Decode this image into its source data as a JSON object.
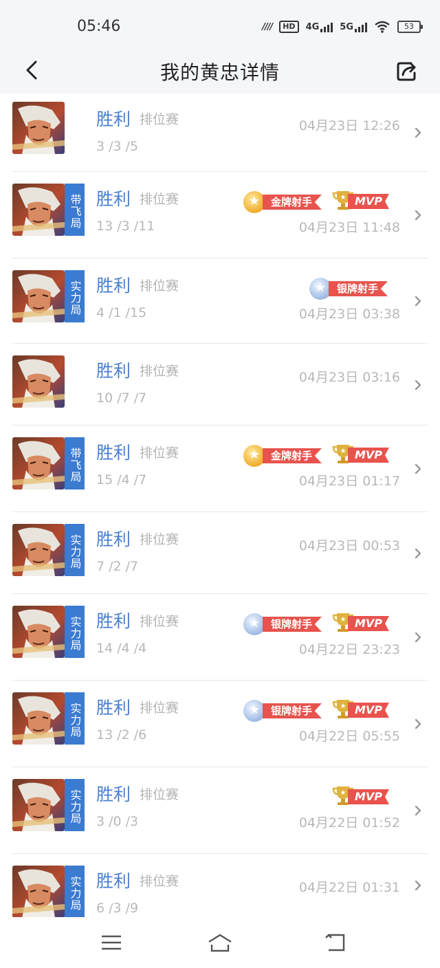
{
  "status": {
    "time": "05:46",
    "hd": "HD",
    "sig4g": "4G",
    "sig5g": "5G",
    "battery": "53"
  },
  "nav": {
    "title": "我的黄忠详情"
  },
  "matches": [
    {
      "result": "胜利",
      "type": "排位赛",
      "kda": "3 /3 /5",
      "date": "04月23日 12:26",
      "mode": "",
      "badges": []
    },
    {
      "result": "胜利",
      "type": "排位赛",
      "kda": "13 /3 /11",
      "date": "04月23日 11:48",
      "mode": "带飞局",
      "badges": [
        "gold",
        "mvp"
      ]
    },
    {
      "result": "胜利",
      "type": "排位赛",
      "kda": "4 /1 /15",
      "date": "04月23日 03:38",
      "mode": "实力局",
      "badges": [
        "silver"
      ]
    },
    {
      "result": "胜利",
      "type": "排位赛",
      "kda": "10 /7 /7",
      "date": "04月23日 03:16",
      "mode": "",
      "badges": []
    },
    {
      "result": "胜利",
      "type": "排位赛",
      "kda": "15 /4 /7",
      "date": "04月23日 01:17",
      "mode": "带飞局",
      "badges": [
        "gold",
        "mvp"
      ]
    },
    {
      "result": "胜利",
      "type": "排位赛",
      "kda": "7 /2 /7",
      "date": "04月23日 00:53",
      "mode": "实力局",
      "badges": []
    },
    {
      "result": "胜利",
      "type": "排位赛",
      "kda": "14 /4 /4",
      "date": "04月22日 23:23",
      "mode": "实力局",
      "badges": [
        "silver",
        "mvp"
      ]
    },
    {
      "result": "胜利",
      "type": "排位赛",
      "kda": "13 /2 /6",
      "date": "04月22日 05:55",
      "mode": "实力局",
      "badges": [
        "silver",
        "mvp"
      ]
    },
    {
      "result": "胜利",
      "type": "排位赛",
      "kda": "3 /0 /3",
      "date": "04月22日 01:52",
      "mode": "实力局",
      "badges": [
        "mvp"
      ]
    },
    {
      "result": "胜利",
      "type": "排位赛",
      "kda": "6 /3 /9",
      "date": "04月22日 01:31",
      "mode": "实力局",
      "badges": []
    }
  ],
  "badge_text": {
    "gold": "金牌射手",
    "silver": "银牌射手",
    "mvp": "MVP"
  }
}
